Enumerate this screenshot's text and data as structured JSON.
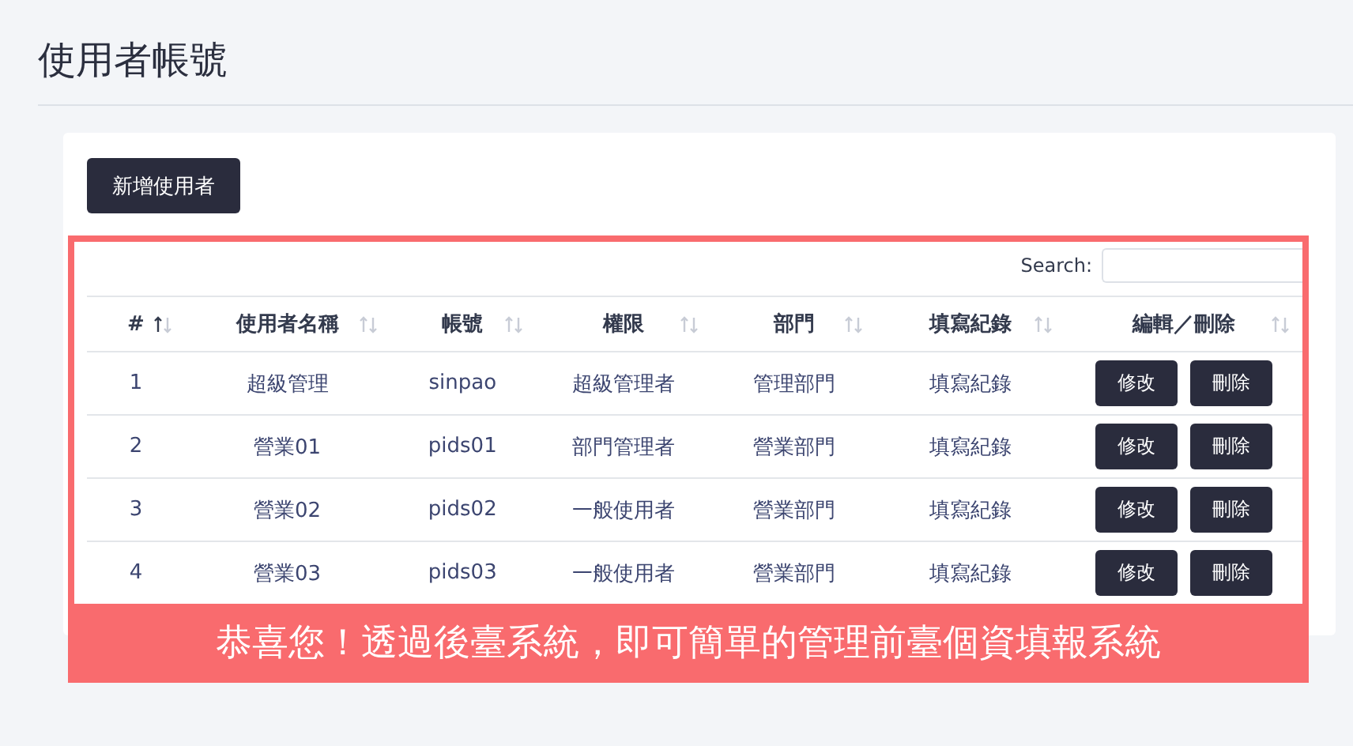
{
  "page_title": "使用者帳號",
  "add_button": "新增使用者",
  "search": {
    "label": "Search:"
  },
  "table": {
    "columns": [
      {
        "label": "#",
        "sorted": true
      },
      {
        "label": "使用者名稱",
        "sorted": false
      },
      {
        "label": "帳號",
        "sorted": false
      },
      {
        "label": "權限",
        "sorted": false
      },
      {
        "label": "部門",
        "sorted": false
      },
      {
        "label": "填寫紀錄",
        "sorted": false
      },
      {
        "label": "編輯／刪除",
        "sorted": false
      }
    ],
    "rows": [
      {
        "cells": [
          "1",
          "超級管理",
          "sinpao",
          "超級管理者",
          "管理部門",
          "填寫紀錄"
        ],
        "actions": [
          "修改",
          "刪除"
        ]
      },
      {
        "cells": [
          "2",
          "營業01",
          "pids01",
          "部門管理者",
          "營業部門",
          "填寫紀錄"
        ],
        "actions": [
          "修改",
          "刪除"
        ]
      },
      {
        "cells": [
          "3",
          "營業02",
          "pids02",
          "一般使用者",
          "營業部門",
          "填寫紀錄"
        ],
        "actions": [
          "修改",
          "刪除"
        ]
      },
      {
        "cells": [
          "4",
          "營業03",
          "pids03",
          "一般使用者",
          "營業部門",
          "填寫紀錄"
        ],
        "actions": [
          "修改",
          "刪除"
        ]
      }
    ]
  },
  "caption": "恭喜您！透過後臺系統，即可簡單的管理前臺個資填報系統"
}
